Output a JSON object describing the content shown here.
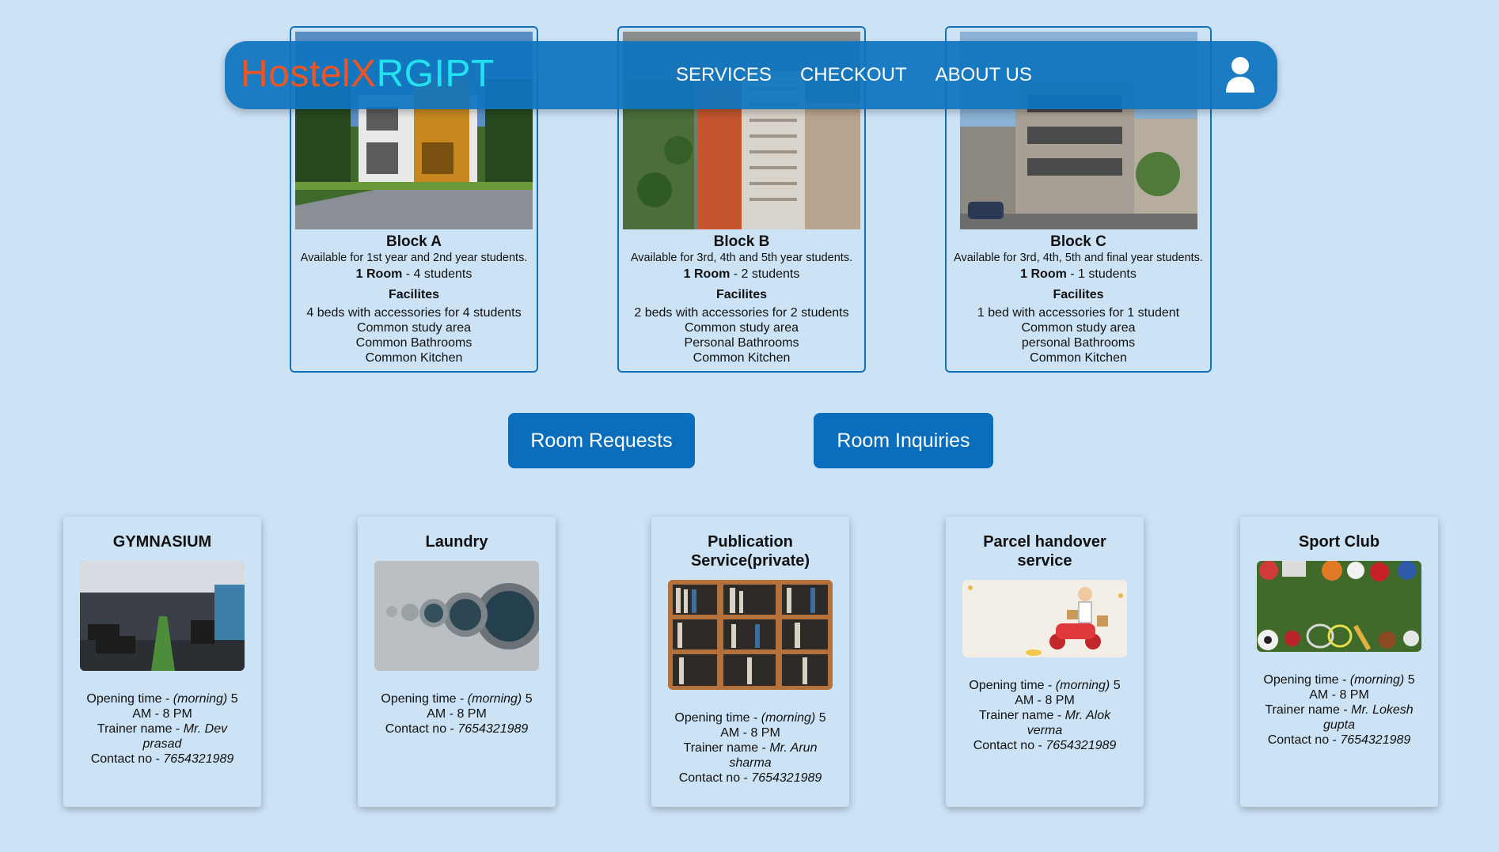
{
  "navbar": {
    "brand_part1": "HostelX",
    "brand_part2": "RGIPT",
    "links": [
      "SERVICES",
      "CHECKOUT",
      "ABOUT US"
    ],
    "user_icon": "user-icon"
  },
  "blocks": [
    {
      "title": "Block A",
      "availability": "Available for 1st year and 2nd year students.",
      "room_bold": "1 Room",
      "room_rest": " - 4 students",
      "facilities_title": "Facilites",
      "facilities": [
        "4 beds with accessories for 4 students",
        "Common study area",
        "Common Bathrooms",
        "Common Kitchen"
      ]
    },
    {
      "title": "Block B",
      "availability": "Available for 3rd, 4th and 5th year students.",
      "room_bold": "1 Room",
      "room_rest": " - 2 students",
      "facilities_title": "Facilites",
      "facilities": [
        "2 beds with accessories for 2 students",
        "Common study area",
        "Personal Bathrooms",
        "Common Kitchen"
      ]
    },
    {
      "title": "Block C",
      "availability": "Available for 3rd, 4th, 5th and final year students.",
      "room_bold": "1 Room",
      "room_rest": " - 1 students",
      "facilities_title": "Facilites",
      "facilities": [
        "1 bed with accessories for 1 student",
        "Common study area",
        "personal Bathrooms",
        "Common Kitchen"
      ]
    }
  ],
  "actions": {
    "room_requests": "Room Requests",
    "room_inquiries": "Room Inquiries"
  },
  "services": [
    {
      "title": "GYMNASIUM",
      "open_prefix": "Opening time - ",
      "open_italic": "(morning)",
      "open_rest": " 5 AM - 8 PM",
      "trainer_prefix": "Trainer name - ",
      "trainer": "Mr. Dev prasad",
      "contact_prefix": "Contact no - ",
      "contact": "7654321989"
    },
    {
      "title": "Laundry",
      "open_prefix": "Opening time - ",
      "open_italic": "(morning)",
      "open_rest": " 5 AM - 8 PM",
      "contact_prefix": "Contact no - ",
      "contact": "7654321989"
    },
    {
      "title": "Publication Service(private)",
      "open_prefix": "Opening time - ",
      "open_italic": "(morning)",
      "open_rest": " 5 AM - 8 PM",
      "trainer_prefix": "Trainer name - ",
      "trainer": "Mr. Arun sharma",
      "contact_prefix": "Contact no - ",
      "contact": "7654321989"
    },
    {
      "title": "Parcel handover service",
      "open_prefix": "Opening time - ",
      "open_italic": "(morning)",
      "open_rest": " 5 AM - 8 PM",
      "trainer_prefix": "Trainer name - ",
      "trainer": "Mr. Alok verma",
      "contact_prefix": "Contact no - ",
      "contact": "7654321989"
    },
    {
      "title": "Sport Club",
      "open_prefix": "Opening time - ",
      "open_italic": "(morning)",
      "open_rest": " 5 AM - 8 PM",
      "trainer_prefix": "Trainer name - ",
      "trainer": "Mr. Lokesh gupta",
      "contact_prefix": "Contact no - ",
      "contact": "7654321989"
    }
  ],
  "colors": {
    "background": "#cce3f6",
    "navbar": "#0e74be",
    "accent": "#0a6ebc",
    "brand_orange": "#ee5522",
    "brand_cyan": "#21e3f0"
  }
}
